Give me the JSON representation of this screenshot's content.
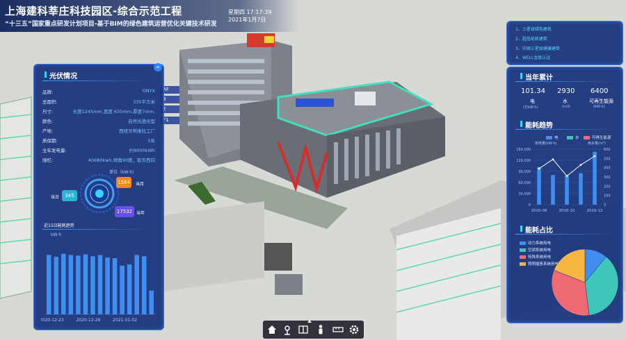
{
  "header": {
    "title": "上海建科莘庄科技园区-综合示范工程",
    "subtitle": "“十三五”国家重点研发计划项目-基于BIM的绿色建筑运营优化关键技术研发",
    "weekday_time": "星期四 17:17:39",
    "date": "2021年1月7日"
  },
  "floors": [
    "RF",
    "3",
    "2",
    "F1"
  ],
  "pv_panel": {
    "title": "光伏情况",
    "rows": [
      {
        "label": "品牌:",
        "value": "ONYX"
      },
      {
        "label": "总面积:",
        "value": "335平方米"
      },
      {
        "label": "尺寸:",
        "value": "长度1245mm,宽度 635mm,厚度7mm."
      },
      {
        "label": "颜色:",
        "value": "自然光透光型"
      },
      {
        "label": "产地:",
        "value": "西班牙阿维拉工厂"
      },
      {
        "label": "质保期:",
        "value": "5年"
      },
      {
        "label": "全年发电量:",
        "value": "约9000kWh"
      },
      {
        "label": "围栏:",
        "value": "40680kwh,倾角90度，取东西向"
      }
    ],
    "unit_label": "单位（kW·h）",
    "today_label": "当日",
    "today_value": "345",
    "month_label": "当月",
    "month_value": "1564",
    "year_label": "当年",
    "year_value": "17532",
    "trend_title": "近15日能耗趋势",
    "trend_unit": "kW·h"
  },
  "goals": [
    "1、三星级绿色建筑",
    "2、超低能耗建筑",
    "3、中国三星级健康建筑",
    "4、WELL金级认证"
  ],
  "year_total": {
    "title": "当年累计",
    "items": [
      {
        "value": "101.34",
        "name": "电",
        "unit": "(万kW·h)"
      },
      {
        "value": "2930",
        "name": "水",
        "unit": "(m3)"
      },
      {
        "value": "6400",
        "name": "可再生能源",
        "unit": "(kW·h)"
      }
    ]
  },
  "trend": {
    "title": "能耗趋势",
    "legend_elec": "电",
    "legend_water": "水",
    "legend_renew": "可再生能源",
    "left_axis_title": "用电量(kW·h)",
    "right_axis_title": "用水量(m³)"
  },
  "share": {
    "title": "能耗占比",
    "items": [
      {
        "label": "动力系统用电",
        "color": "#3f8ff0"
      },
      {
        "label": "空调系统用电",
        "color": "#3ec7b8"
      },
      {
        "label": "特殊系统用电",
        "color": "#f06a73"
      },
      {
        "label": "照明插座系统用电",
        "color": "#f5b642"
      }
    ]
  },
  "colors": {
    "accent": "#39d3ff",
    "panel": "#122c78",
    "bar": "#3f8ff0"
  },
  "chart_data": [
    {
      "type": "bar",
      "title": "近15日能耗趋势",
      "ylabel": "kW·h",
      "x_ticks": [
        "2020-12-23",
        "2020-12-28",
        "2021-01-02"
      ],
      "values": [
        95,
        92,
        97,
        95,
        94,
        96,
        93,
        95,
        91,
        90,
        78,
        80,
        95,
        93,
        38
      ],
      "ylim": [
        0,
        120
      ]
    },
    {
      "type": "bar",
      "title": "能耗趋势",
      "categories": [
        "2020-08",
        "2020-09",
        "2020-10",
        "2020-11",
        "2020-12"
      ],
      "series": [
        {
          "name": "电",
          "kind": "bar",
          "axis": "left",
          "values": [
            102000,
            80000,
            78000,
            85000,
            143000
          ]
        },
        {
          "name": "水",
          "kind": "line",
          "axis": "right",
          "values": [
            390,
            490,
            310,
            430,
            525
          ]
        }
      ],
      "y_left_ticks": [
        "0",
        "30,000",
        "60,000",
        "90,000",
        "120,000",
        "150,000"
      ],
      "y_right_ticks": [
        "0",
        "100",
        "200",
        "300",
        "400",
        "500",
        "600"
      ],
      "ylim_left": [
        0,
        150000
      ],
      "ylim_right": [
        0,
        600
      ],
      "x_ticks": [
        "2020-08",
        "2020-10",
        "2020-12"
      ],
      "legend": "top"
    },
    {
      "type": "pie",
      "title": "能耗占比",
      "labels": [
        "动力系统用电",
        "空调系统用电",
        "特殊系统用电",
        "照明插座系统用电"
      ],
      "values": [
        11,
        37,
        33,
        19
      ]
    }
  ]
}
